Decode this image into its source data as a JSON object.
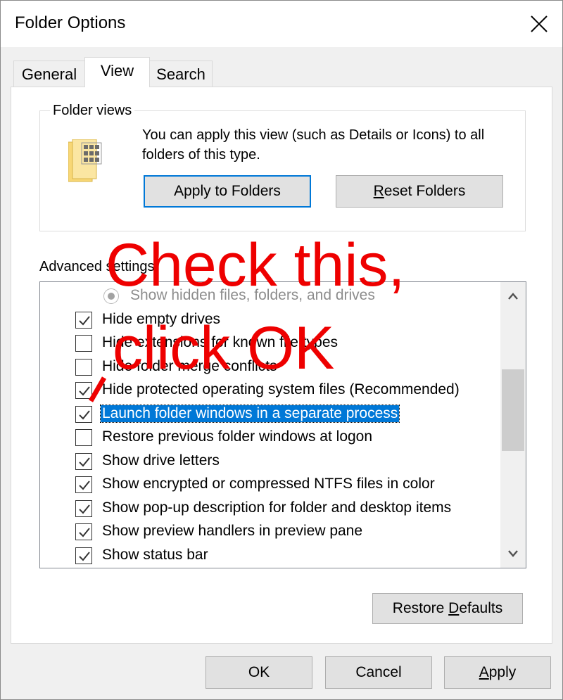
{
  "window": {
    "title": "Folder Options"
  },
  "tabs": [
    {
      "label": "General",
      "active": false
    },
    {
      "label": "View",
      "active": true
    },
    {
      "label": "Search",
      "active": false
    }
  ],
  "folder_views": {
    "group_label": "Folder views",
    "description": "You can apply this view (such as Details or Icons) to all folders of this type.",
    "apply_button": "Apply to Folders",
    "reset_button_prefix": "",
    "reset_button_underline": "R",
    "reset_button_rest": "eset Folders"
  },
  "advanced": {
    "label": "Advanced settings:",
    "items": [
      {
        "type": "radio",
        "label": "Show hidden files, folders, and drives",
        "checked": true
      },
      {
        "type": "checkbox",
        "label": "Hide empty drives",
        "checked": true
      },
      {
        "type": "checkbox",
        "label": "Hide extensions for known file types",
        "checked": false
      },
      {
        "type": "checkbox",
        "label": "Hide folder merge conflicts",
        "checked": false
      },
      {
        "type": "checkbox",
        "label": "Hide protected operating system files (Recommended)",
        "checked": true
      },
      {
        "type": "checkbox",
        "label": "Launch folder windows in a separate process",
        "checked": true,
        "selected": true
      },
      {
        "type": "checkbox",
        "label": "Restore previous folder windows at logon",
        "checked": false
      },
      {
        "type": "checkbox",
        "label": "Show drive letters",
        "checked": true
      },
      {
        "type": "checkbox",
        "label": "Show encrypted or compressed NTFS files in color",
        "checked": true
      },
      {
        "type": "checkbox",
        "label": "Show pop-up description for folder and desktop items",
        "checked": true
      },
      {
        "type": "checkbox",
        "label": "Show preview handlers in preview pane",
        "checked": true
      },
      {
        "type": "checkbox",
        "label": "Show status bar",
        "checked": true
      }
    ]
  },
  "restore_defaults": {
    "prefix": "Restore ",
    "underline": "D",
    "rest": "efaults"
  },
  "footer": {
    "ok": "OK",
    "cancel": "Cancel",
    "apply_underline": "A",
    "apply_rest": "pply"
  },
  "annotation": {
    "line1": "Check this,",
    "line2": "click OK",
    "color": "#ee0000"
  },
  "colors": {
    "accent": "#0078d7",
    "selection": "#0078d7",
    "button_face": "#e1e1e1"
  }
}
